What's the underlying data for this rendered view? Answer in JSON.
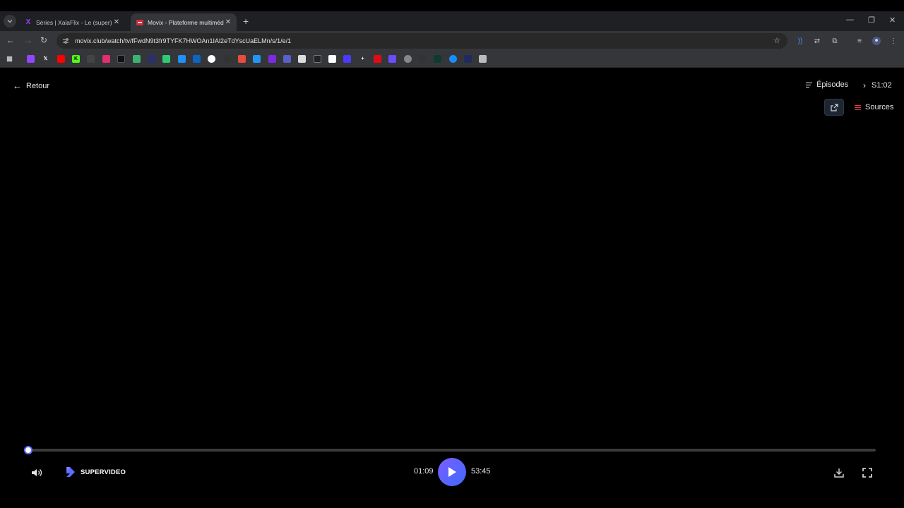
{
  "browser": {
    "tabs": [
      {
        "title": "Séries | XalaFlix - Le (super) site",
        "favicon": "x-logo-purple",
        "active": false
      },
      {
        "title": "Movix - Plateforme multimédia",
        "favicon": "movix-logo-red",
        "active": true
      }
    ],
    "new_tab": "+",
    "url": "movix.club/watch/tv/fFwdN9t3fr9TYFK7HWOAn1IAl2eTdYscUaELMn/s/1/e/1",
    "bookmarks_count": 30
  },
  "page": {
    "back_label": "Retour",
    "episodes_label": "Épisodes",
    "season_episode": "S1:02",
    "sources_label": "Sources"
  },
  "player": {
    "brand": "SUPERVIDEO",
    "current_time": "01:09",
    "duration": "53:45",
    "progress_fraction": 0.0,
    "accent_color": "#5b6cff"
  }
}
